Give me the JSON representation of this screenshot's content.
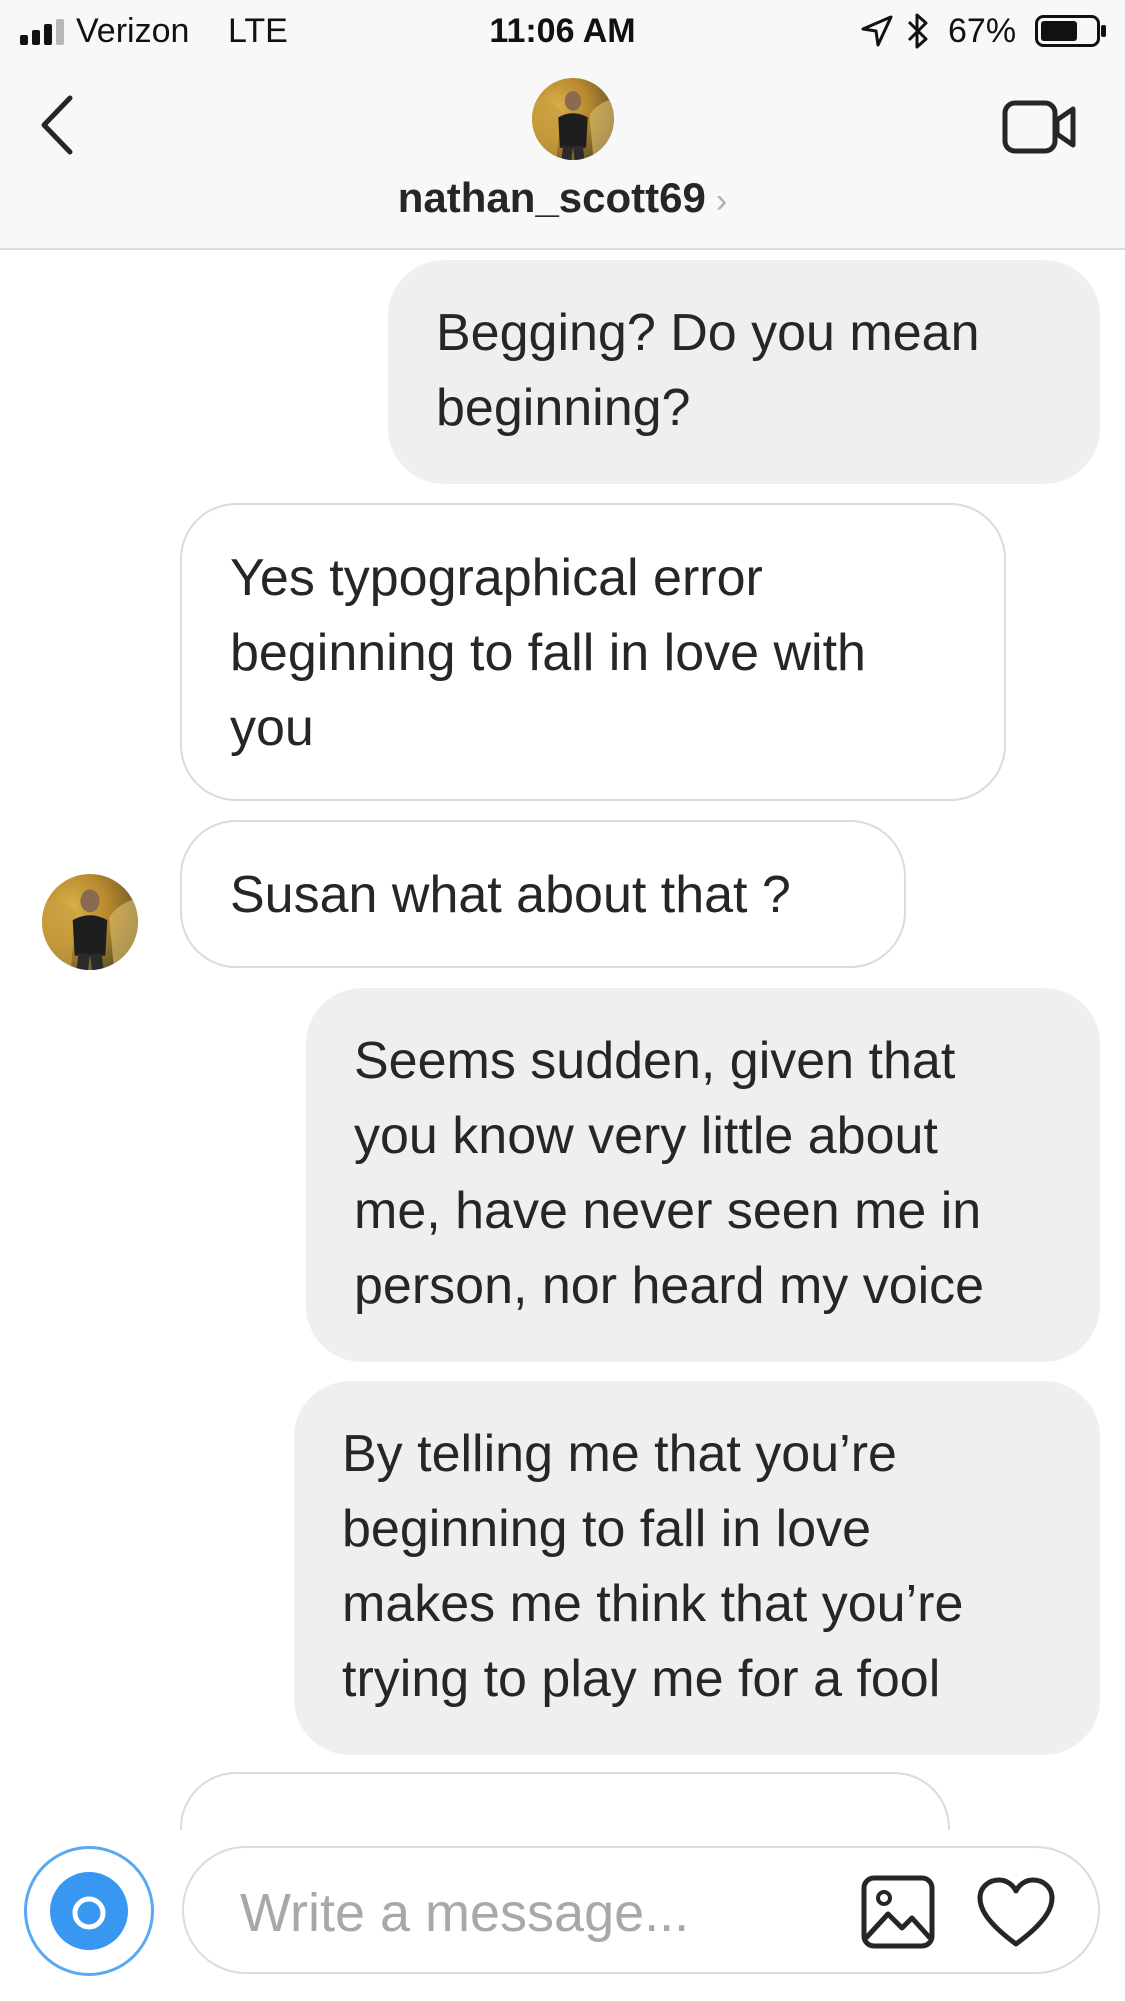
{
  "status_bar": {
    "carrier": "Verizon",
    "network": "LTE",
    "time": "11:06 AM",
    "battery_percent": "67%",
    "battery_level": 0.67,
    "icons": [
      "signal-icon",
      "location-arrow-icon",
      "bluetooth-icon",
      "battery-icon"
    ]
  },
  "header": {
    "username": "nathan_scott69",
    "chevron": "›",
    "icons": [
      "back-chevron-icon",
      "avatar",
      "video-camera-icon"
    ]
  },
  "messages": [
    {
      "direction": "sent",
      "text": "Begging? Do you mean\nbeginning?"
    },
    {
      "direction": "received",
      "text": "Yes typographical error\nbeginning to fall in love with\nyou"
    },
    {
      "direction": "received",
      "text": "Susan what about that ?"
    },
    {
      "direction": "sent",
      "text": "Seems sudden, given that\nyou know very little about\nme, have never seen me in\nperson, nor heard my voice"
    },
    {
      "direction": "sent",
      "text": "By telling me that you’re\nbeginning to fall in love\nmakes me think that you’re\ntrying to play me for a fool"
    }
  ],
  "composer": {
    "placeholder": "Write a message...",
    "icons": [
      "camera-icon",
      "image-gallery-icon",
      "heart-icon"
    ]
  },
  "colors": {
    "bar_background": "#f8f8f8",
    "sent_bubble": "#efefef",
    "received_border": "#dbdbdb",
    "accent_blue": "#3897f0",
    "text": "#262626",
    "placeholder": "#a8a8a8"
  }
}
